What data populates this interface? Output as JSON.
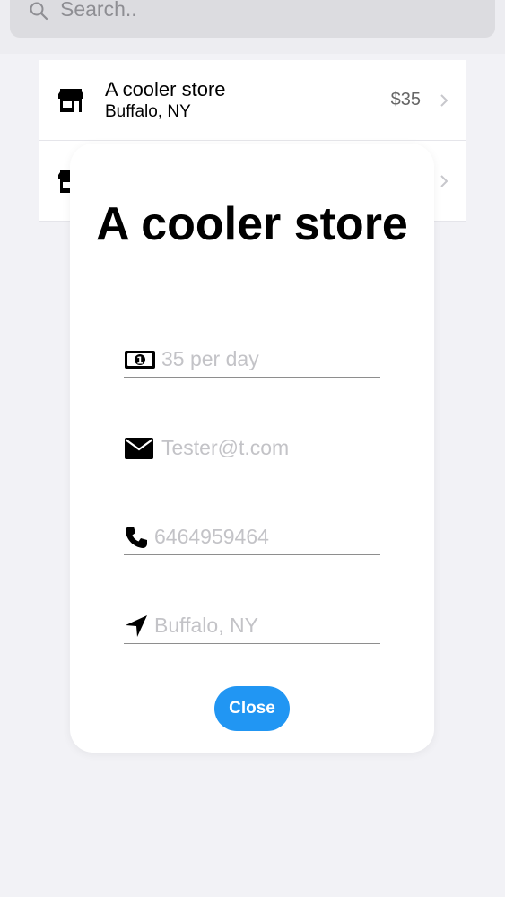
{
  "search": {
    "placeholder": "Search.."
  },
  "list": {
    "rows": [
      {
        "title": "A cooler store",
        "subtitle": "Buffalo, NY",
        "price": "$35"
      },
      {
        "title": "",
        "subtitle": "",
        "price": ""
      }
    ]
  },
  "modal": {
    "title": "A cooler store",
    "fields": {
      "price": "35 per day",
      "email": "Tester@t.com",
      "phone": "6464959464",
      "location": "Buffalo, NY"
    },
    "close_label": "Close"
  },
  "colors": {
    "accent": "#2196f3",
    "placeholder": "#c3c3c7"
  },
  "icons": [
    "search-icon",
    "store-icon",
    "chevron-right-icon",
    "money-icon",
    "mail-icon",
    "phone-icon",
    "location-arrow-icon"
  ]
}
